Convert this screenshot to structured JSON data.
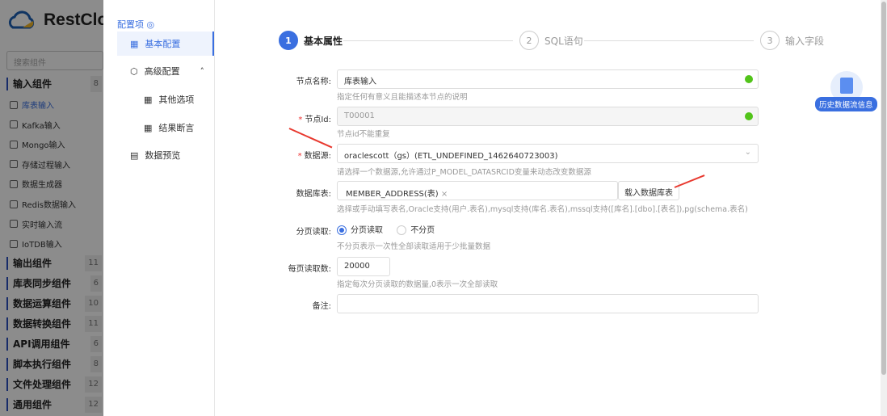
{
  "app": {
    "logo_text": "RestCloud",
    "search_placeholder": "搜索组件"
  },
  "palette": {
    "groups": [
      {
        "label": "输入组件",
        "count": "8",
        "items": [
          "库表输入",
          "Kafka输入",
          "Mongo输入",
          "存储过程输入",
          "数据生成器",
          "Redis数据输入",
          "实时输入流",
          "IoTDB输入"
        ]
      },
      {
        "label": "输出组件",
        "count": "11"
      },
      {
        "label": "库表同步组件",
        "count": "6"
      },
      {
        "label": "数据运算组件",
        "count": "10"
      },
      {
        "label": "数据转换组件",
        "count": "11"
      },
      {
        "label": "API调用组件",
        "count": "6"
      },
      {
        "label": "脚本执行组件",
        "count": "8"
      },
      {
        "label": "文件处理组件",
        "count": "12"
      },
      {
        "label": "通用组件",
        "count": "12"
      }
    ]
  },
  "nav": {
    "title": "配置项",
    "items": [
      {
        "label": "基本配置"
      },
      {
        "label": "高级配置"
      },
      {
        "label": "其他选项"
      },
      {
        "label": "结果断言"
      },
      {
        "label": "数据预览"
      }
    ]
  },
  "steps": [
    {
      "num": "1",
      "label": "基本属性"
    },
    {
      "num": "2",
      "label": "SQL语句"
    },
    {
      "num": "3",
      "label": "输入字段"
    }
  ],
  "form": {
    "node_name": {
      "label": "节点名称:",
      "value": "库表输入",
      "hint": "指定任何有意义且能描述本节点的说明"
    },
    "node_id": {
      "label": "节点Id:",
      "value": "T00001",
      "hint": "节点id不能重复"
    },
    "datasource": {
      "label": "数据源:",
      "value": "oraclescott（gs）(ETL_UNDEFINED_1462640723003)",
      "hint": "请选择一个数据源,允许通过P_MODEL_DATASRCID变量来动态改变数据源"
    },
    "table": {
      "label": "数据库表:",
      "tag": "MEMBER_ADDRESS(表)",
      "button": "载入数据库表",
      "hint": "选择或手动填写表名,Oracle支持(用户.表名),mysql支持(库名.表名),mssql支持([库名].[dbo].[表名]),pg(schema.表名)"
    },
    "paging": {
      "label": "分页读取:",
      "option1": "分页读取",
      "option2": "不分页",
      "selected": "分页读取",
      "hint": "不分页表示一次性全部读取适用于少批量数据"
    },
    "page_size": {
      "label": "每页读取数:",
      "value": "20000",
      "hint": "指定每次分页读取的数据量,0表示一次全部读取"
    },
    "remark": {
      "label": "备注:",
      "value": ""
    }
  },
  "float_badge": {
    "label": "历史数据流信息"
  },
  "colors": {
    "accent": "#3a6fe0",
    "arrow": "#e8392f",
    "success": "#52c41a"
  }
}
